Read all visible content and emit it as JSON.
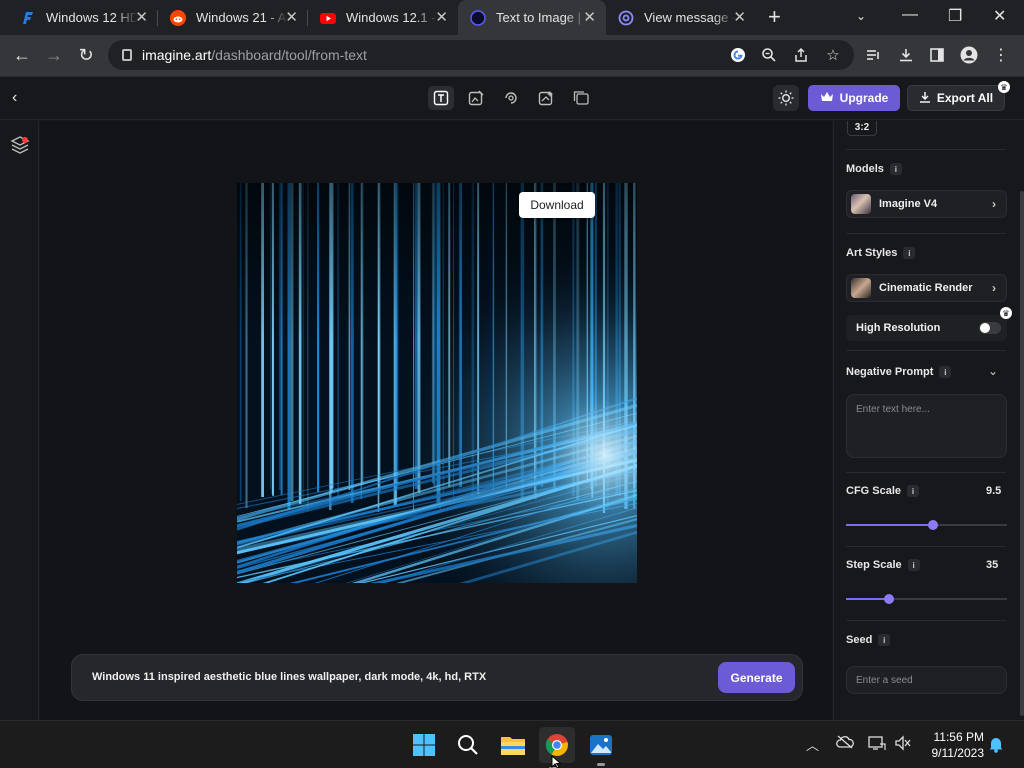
{
  "browser": {
    "tabs": [
      {
        "title": "Windows 12 HD",
        "icon": "feather-favicon",
        "color": "#2a7bd8"
      },
      {
        "title": "Windows 21 - A",
        "icon": "reddit-favicon",
        "color": "#ff4500"
      },
      {
        "title": "Windows 12.1 -",
        "icon": "youtube-favicon",
        "color": "#ff0000"
      },
      {
        "title": "Text to Image | I",
        "icon": "imagine-favicon",
        "color": "#1a1a8a"
      },
      {
        "title": "View message -",
        "icon": "at-sign-favicon",
        "color": "#7b7bff"
      }
    ],
    "url_host": "imagine.art",
    "url_path": "/dashboard/tool/from-text"
  },
  "app": {
    "upgrade_label": "Upgrade",
    "export_label": "Export All",
    "download_label": "Download",
    "prompt_text": "Windows 11 inspired aesthetic blue lines wallpaper, dark mode, 4k, hd, RTX",
    "generate_label": "Generate",
    "accent": "#6b5bd6"
  },
  "panel": {
    "aspect_ratio": "3:2",
    "models_label": "Models",
    "model_value": "Imagine V4",
    "art_styles_label": "Art Styles",
    "art_style_value": "Cinematic Render",
    "high_res_label": "High Resolution",
    "high_res_on": false,
    "negative_prompt_label": "Negative Prompt",
    "negative_prompt_placeholder": "Enter text here...",
    "cfg_label": "CFG Scale",
    "cfg_value": "9.5",
    "cfg_fraction": 0.54,
    "step_label": "Step Scale",
    "step_value": "35",
    "step_fraction": 0.27,
    "seed_label": "Seed",
    "seed_placeholder": "Enter a seed"
  },
  "taskbar": {
    "time": "11:56 PM",
    "date": "9/11/2023"
  }
}
